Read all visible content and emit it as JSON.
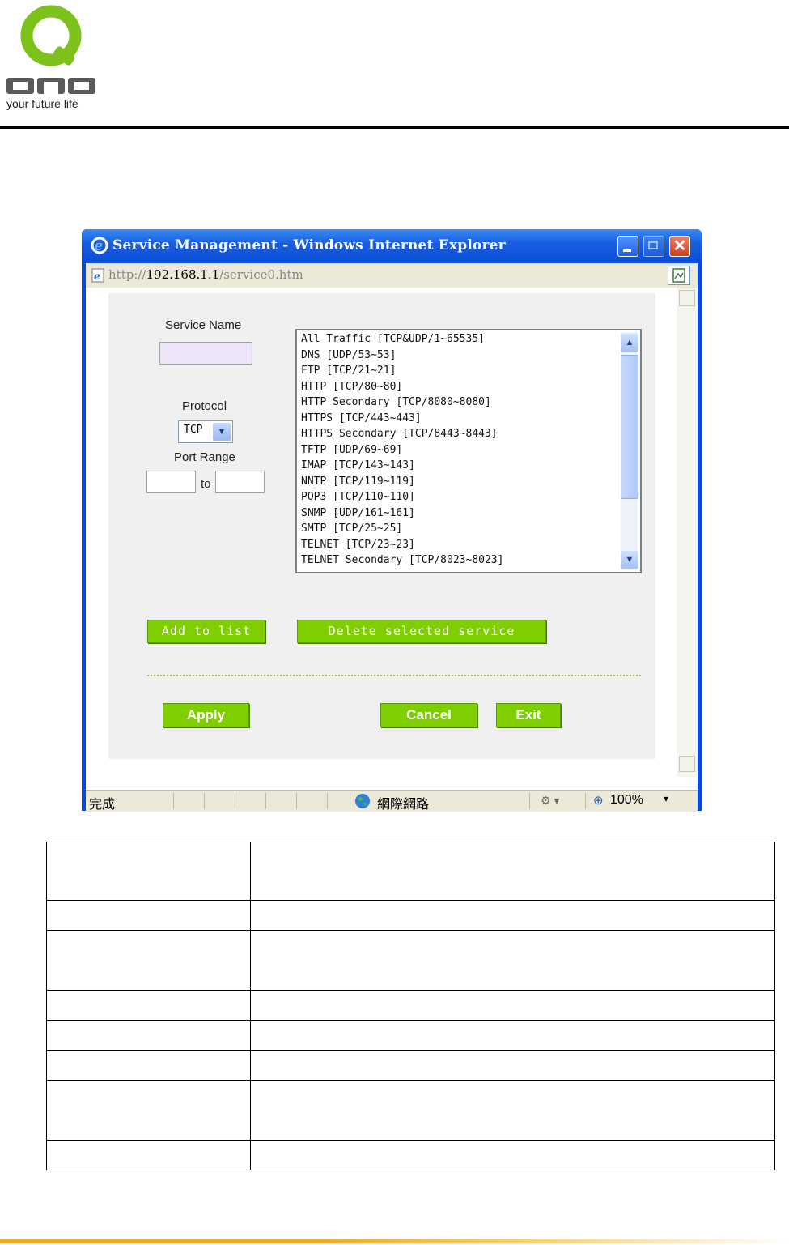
{
  "logo": {
    "brand": "QNO",
    "tagline": "your future life"
  },
  "window": {
    "title": "Service Management - Windows Internet Explorer",
    "address": {
      "prefix": "http://",
      "host": "192.168.1.1",
      "path": "/service0.htm"
    }
  },
  "form": {
    "service_name_label": "Service Name",
    "service_name_value": "",
    "protocol_label": "Protocol",
    "protocol_value": "TCP",
    "port_range_label": "Port Range",
    "port_from_value": "",
    "port_to_label": "to",
    "port_to_value": ""
  },
  "services": [
    "All Traffic [TCP&UDP/1~65535]",
    "DNS [UDP/53~53]",
    "FTP [TCP/21~21]",
    "HTTP [TCP/80~80]",
    "HTTP Secondary [TCP/8080~8080]",
    "HTTPS [TCP/443~443]",
    "HTTPS Secondary [TCP/8443~8443]",
    "TFTP [UDP/69~69]",
    "IMAP [TCP/143~143]",
    "NNTP [TCP/119~119]",
    "POP3 [TCP/110~110]",
    "SNMP [UDP/161~161]",
    "SMTP [TCP/25~25]",
    "TELNET [TCP/23~23]",
    "TELNET Secondary [TCP/8023~8023]"
  ],
  "buttons": {
    "add": "Add to list",
    "delete": "Delete selected service",
    "apply": "Apply",
    "cancel": "Cancel",
    "exit": "Exit"
  },
  "statusbar": {
    "done": "完成",
    "zone": "網際網路",
    "zoom": "100%"
  },
  "table_rows": 8,
  "colors": {
    "button_green": "#7fcf00",
    "title_blue": "#0b4bd6",
    "footer_orange": "#f5a623"
  }
}
